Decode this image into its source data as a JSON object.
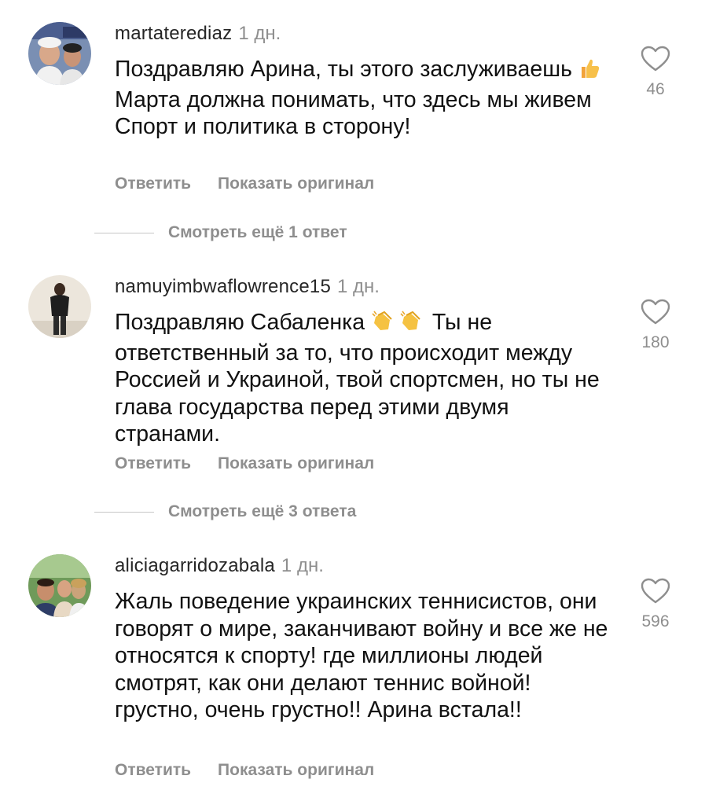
{
  "comments": [
    {
      "username": "martaterediaz",
      "time": "1 дн.",
      "text_before": "Поздравляю Арина, ты этого заслуживаешь ",
      "emoji": "thumbs-up",
      "text_after": " Марта должна понимать, что здесь мы живем Спорт и политика в сторону!",
      "likes": "46",
      "reply_label": "Ответить",
      "original_label": "Показать оригинал",
      "more_replies": "Смотреть ещё 1 ответ"
    },
    {
      "username": "namuyimbwaflowrence15",
      "time": "1 дн.",
      "text_before": "Поздравляю Сабаленка ",
      "emoji": "clapping-hands",
      "text_after": " Ты не ответственный за то, что происходит между Россией и Украиной, твой спортсмен, но ты не глава государства перед этими двумя странами.",
      "likes": "180",
      "reply_label": "Ответить",
      "original_label": "Показать оригинал",
      "more_replies": "Смотреть ещё 3 ответа"
    },
    {
      "username": "aliciagarridozabala",
      "time": "1 дн.",
      "text": "Жаль поведение украинских теннисистов, они говорят о мире, заканчивают войну и все же не относятся к спорту! где миллионы людей смотрят, как они делают теннис войной! грустно, очень грустно!! Арина встала!!",
      "likes": "596",
      "reply_label": "Ответить",
      "original_label": "Показать оригинал"
    }
  ],
  "colors": {
    "text": "#111111",
    "secondary": "#8e8e8e",
    "divider": "#c7c7c7"
  },
  "icons": [
    "heart-outline-icon",
    "thumbs-up-emoji",
    "clapping-hands-emoji"
  ]
}
